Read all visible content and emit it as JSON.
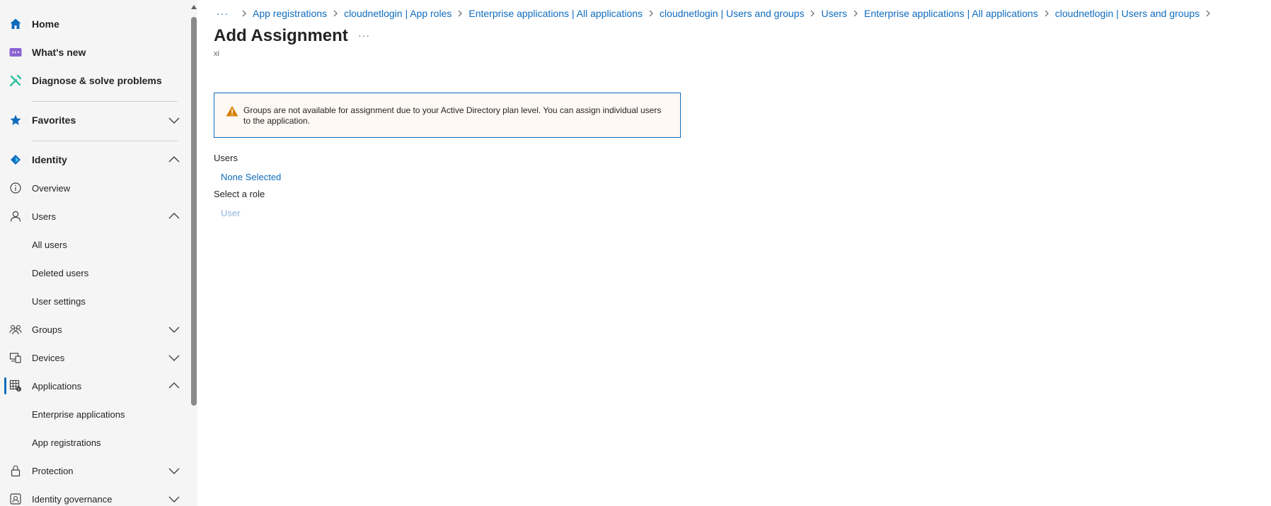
{
  "sidebar": {
    "home": "Home",
    "whats_new": "What's new",
    "diagnose": "Diagnose & solve problems",
    "favorites": "Favorites",
    "identity": "Identity",
    "overview": "Overview",
    "users": "Users",
    "all_users": "All users",
    "deleted_users": "Deleted users",
    "user_settings": "User settings",
    "groups": "Groups",
    "devices": "Devices",
    "applications": "Applications",
    "enterprise_applications": "Enterprise applications",
    "app_registrations": "App registrations",
    "protection": "Protection",
    "identity_governance": "Identity governance"
  },
  "breadcrumb": {
    "more": "···",
    "items": [
      "App registrations",
      "cloudnetlogin | App roles",
      "Enterprise applications | All applications",
      "cloudnetlogin | Users and groups",
      "Users",
      "Enterprise applications | All applications",
      "cloudnetlogin | Users and groups"
    ]
  },
  "page": {
    "title": "Add Assignment",
    "more": "···",
    "subtitle": "xi"
  },
  "warning": {
    "text": "Groups are not available for assignment due to your Active Directory plan level. You can assign individual users to the application."
  },
  "form": {
    "users_label": "Users",
    "users_value": "None Selected",
    "role_label": "Select a role",
    "role_value": "User"
  },
  "colors": {
    "accent": "#0f6cbd",
    "warning_icon": "#d67f00",
    "whats_new_icon": "#8a63d2",
    "diagnose_icon": "#2fbfa0"
  }
}
